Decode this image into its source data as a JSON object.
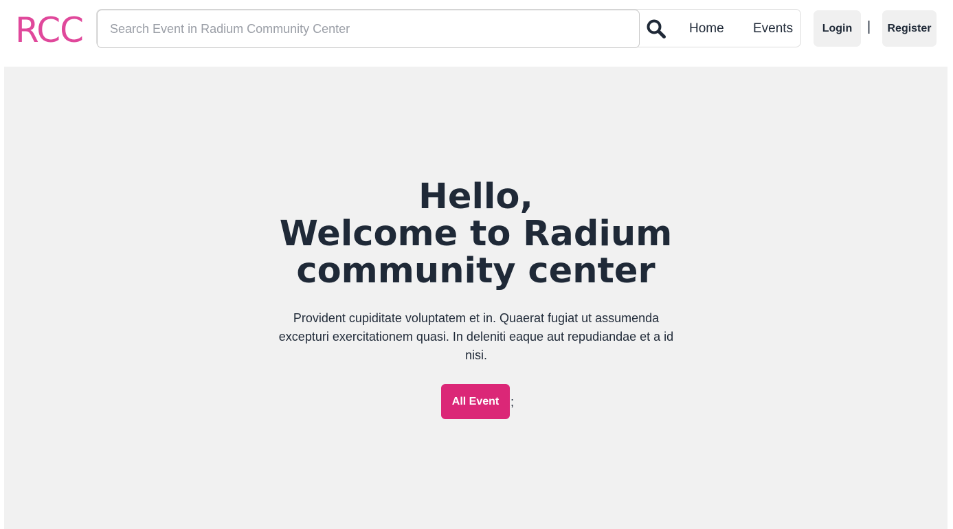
{
  "header": {
    "logo": "RCC",
    "search": {
      "placeholder": "Search Event in Radium Community Center",
      "value": "",
      "icon": "search-icon"
    },
    "nav": {
      "home": "Home",
      "events": "Events"
    },
    "auth": {
      "login": "Login",
      "separator": "|",
      "register": "Register"
    }
  },
  "hero": {
    "title_lines": [
      "Hello,",
      "Welcome to Radium",
      "community center"
    ],
    "description": "Provident cupiditate voluptatem et in. Quaerat fugiat ut assumenda excepturi exercitationem quasi. In deleniti eaque aut repudiandae et a id nisi.",
    "cta_label": "All Event",
    "cta_trailing": ";"
  },
  "colors": {
    "brand": "#e0489b",
    "accent": "#db2777",
    "hero_background": "#f1f1f1",
    "text": "#1f2937"
  }
}
